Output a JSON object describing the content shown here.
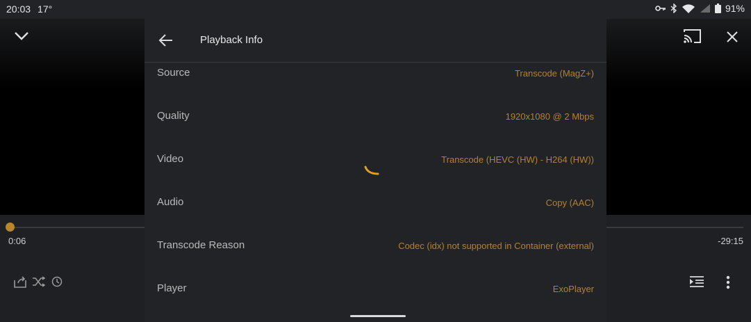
{
  "status_bar": {
    "time": "20:03",
    "temperature": "17°",
    "battery": "91%"
  },
  "player": {
    "elapsed": "0:06",
    "remaining": "-29:15",
    "progress": 0.003
  },
  "dialog": {
    "title": "Playback Info",
    "rows": [
      {
        "label": "Source",
        "value": "Transcode (MagZ+)"
      },
      {
        "label": "Quality",
        "value": "1920x1080 @ 2 Mbps"
      },
      {
        "label": "Video",
        "value": "Transcode (HEVC (HW) - H264 (HW))"
      },
      {
        "label": "Audio",
        "value": "Copy (AAC)"
      },
      {
        "label": "Transcode Reason",
        "value": "Codec (idx) not supported in Container (external)"
      },
      {
        "label": "Player",
        "value": "ExoPlayer"
      }
    ]
  },
  "colors": {
    "accent": "#b58226",
    "dialog_bg": "#222326"
  },
  "icons": [
    "key-icon",
    "bluetooth-icon",
    "wifi-icon",
    "signal-icon",
    "battery-icon",
    "chevron-down-icon",
    "cast-icon",
    "close-icon",
    "back-arrow-icon",
    "loading-spinner-icon",
    "share-icon",
    "shuffle-icon",
    "timer-icon",
    "queue-icon",
    "more-vert-icon"
  ]
}
